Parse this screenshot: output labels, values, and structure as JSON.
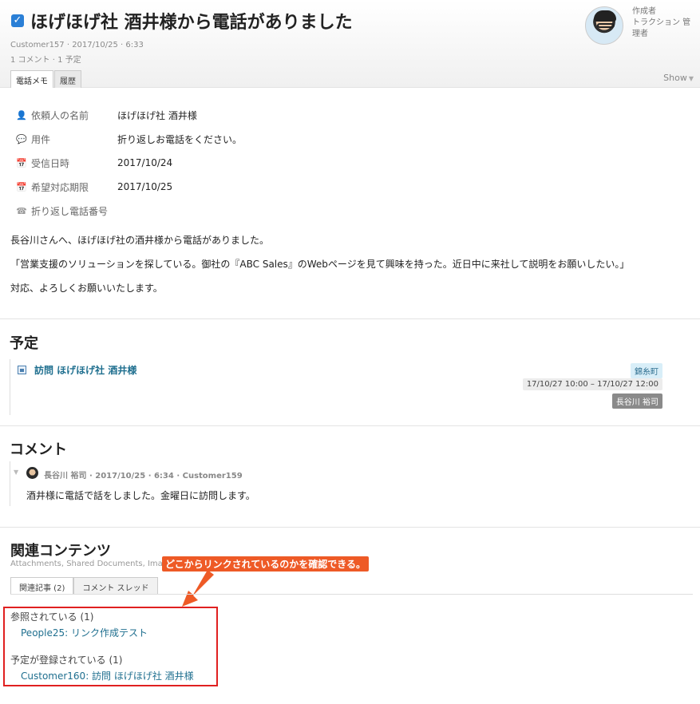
{
  "header": {
    "checked": true,
    "title": "ほげほげ社 酒井様から電話がありました",
    "meta_line1": "Customer157 · 2017/10/25 · 6:33",
    "meta_line2": "1 コメント · 1 予定",
    "tabs": [
      "電話メモ",
      "履歴"
    ],
    "show_label": "Show",
    "author_label": "作成者",
    "author_name": "トラクション 管理者"
  },
  "fields": [
    {
      "icon": "person-icon",
      "label": "依頼人の名前",
      "value": "ほげほげ社 酒井様"
    },
    {
      "icon": "speech-bubble-icon",
      "label": "用件",
      "value": "折り返しお電話をください。"
    },
    {
      "icon": "calendar-icon",
      "label": "受信日時",
      "value": "2017/10/24"
    },
    {
      "icon": "calendar-icon",
      "label": "希望対応期限",
      "value": "2017/10/25"
    },
    {
      "icon": "phone-icon",
      "label": "折り返し電話番号",
      "value": ""
    }
  ],
  "body": {
    "line1": "長谷川さんへ、ほげほげ社の酒井様から電話がありました。",
    "line2": "「営業支援のソリューションを探している。御社の『ABC Sales』のWebページを見て興味を持った。近日中に来社して説明をお願いしたい。」",
    "line3": "対応、よろしくお願いいたします。"
  },
  "schedule": {
    "title": "予定",
    "item_label": "訪問 ほげほげ社 酒井様",
    "place": "錦糸町",
    "time": "17/10/27 10:00 – 17/10/27 12:00",
    "person": "長谷川 裕司"
  },
  "comments": {
    "title": "コメント",
    "meta": "長谷川 裕司 · 2017/10/25 · 6:34 · Customer159",
    "text": "酒井様に電話で話をしました。金曜日に訪問します。"
  },
  "related": {
    "title": "関連コンテンツ",
    "subtitle": "Attachments, Shared Documents, Imag",
    "callout": "どこからリンクされているのかを確認できる。",
    "tabs": [
      "関連記事 (2)",
      "コメント スレッド"
    ],
    "groups": [
      {
        "label": "参照されている (1)",
        "link": "People25: リンク作成テスト"
      },
      {
        "label": "予定が登録されている (1)",
        "link": "Customer160: 訪問 ほげほげ社 酒井様"
      }
    ]
  },
  "colors": {
    "accent": "#2a7fd6",
    "link": "#1f6f8f",
    "callout": "#ee5a26",
    "highlight_box": "#e02020"
  }
}
